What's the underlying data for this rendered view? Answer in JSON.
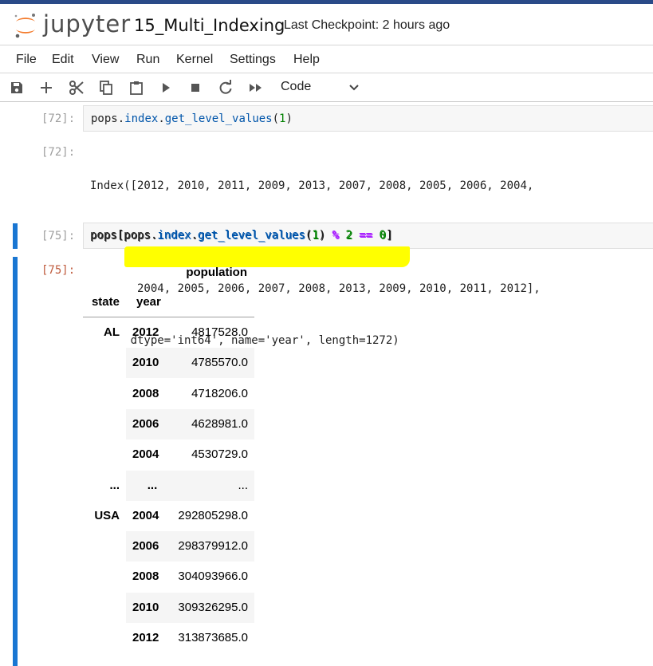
{
  "header": {
    "logo_text": "jupyter",
    "notebook_title": "15_Multi_Indexing",
    "checkpoint": "Last Checkpoint: 2 hours ago"
  },
  "menu": [
    "File",
    "Edit",
    "View",
    "Run",
    "Kernel",
    "Settings",
    "Help"
  ],
  "toolbar": {
    "buttons": [
      "save-icon",
      "add-icon",
      "cut-icon",
      "copy-icon",
      "paste-icon",
      "run-icon",
      "stop-icon",
      "restart-icon",
      "fast-forward-icon"
    ],
    "cell_type": "Code"
  },
  "cells": [
    {
      "in_prompt": "[72]:",
      "code": "pops.index.get_level_values(1)",
      "out_prompt": "[72]:",
      "output_lines": [
        "Index([2012, 2010, 2011, 2009, 2013, 2007, 2008, 2005, 2006, 2004,",
        "       ...",
        "       2004, 2005, 2006, 2007, 2008, 2013, 2009, 2010, 2011, 2012],",
        "      dtype='int64', name='year', length=1272)"
      ]
    },
    {
      "in_prompt": "[75]:",
      "code": "pops[pops.index.get_level_values(1) % 2 == 0]",
      "out_prompt": "[75]:"
    }
  ],
  "dataframe": {
    "column_header": "population",
    "index_names": [
      "state",
      "year"
    ],
    "rows": [
      {
        "state": "AL",
        "year": "2012",
        "population": "4817528.0"
      },
      {
        "state": "",
        "year": "2010",
        "population": "4785570.0"
      },
      {
        "state": "",
        "year": "2008",
        "population": "4718206.0"
      },
      {
        "state": "",
        "year": "2006",
        "population": "4628981.0"
      },
      {
        "state": "",
        "year": "2004",
        "population": "4530729.0"
      },
      {
        "state": "...",
        "year": "...",
        "population": "..."
      },
      {
        "state": "USA",
        "year": "2004",
        "population": "292805298.0"
      },
      {
        "state": "",
        "year": "2006",
        "population": "298379912.0"
      },
      {
        "state": "",
        "year": "2008",
        "population": "304093966.0"
      },
      {
        "state": "",
        "year": "2010",
        "population": "309326295.0"
      },
      {
        "state": "",
        "year": "2012",
        "population": "313873685.0"
      }
    ]
  },
  "colors": {
    "active_cell_bar": "#1976d2",
    "highlight": "#ffff00",
    "output_prompt": "#bf5b3d"
  }
}
